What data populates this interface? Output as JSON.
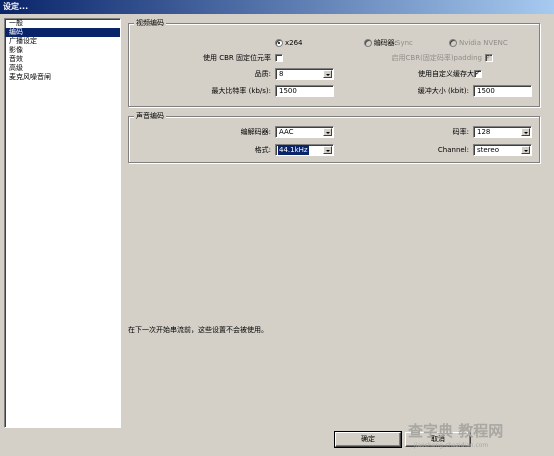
{
  "window": {
    "title": "设定..."
  },
  "nav": {
    "items": [
      "一般",
      "编码",
      "广播设定",
      "影像",
      "音效",
      "高级",
      "麦克风噪音闸"
    ]
  },
  "video_group": {
    "legend": "视频编码",
    "encoder_label": "编码器:",
    "opt_x264": "x264",
    "opt_quicksync": "Quick Sync",
    "opt_nvenc": "Nvidia NVENC",
    "cbr_label": "使用 CBR 固定位元率",
    "cbr_padding_label": "启用CBR(固定码率)padding",
    "cbr_padding_mark": "✓",
    "quality_label": "品质:",
    "quality_value": "8",
    "custom_buffer_label": "使用自定义缓存大小",
    "custom_buffer_mark": "✓",
    "max_bitrate_label": "最大比特率 (kb/s):",
    "max_bitrate_value": "1500",
    "buffer_size_label": "缓冲大小 (kbit):",
    "buffer_size_value": "1500"
  },
  "audio_group": {
    "legend": "声音编码",
    "codec_label": "编解码器:",
    "codec_value": "AAC",
    "bitrate_label": "码率:",
    "bitrate_value": "128",
    "format_label": "格式:",
    "format_value": "44.1kHz",
    "channel_label": "Channel:",
    "channel_value": "stereo"
  },
  "note": "在下一次开始串流前，这些设置不会被使用。",
  "buttons": {
    "ok": "确定",
    "cancel": "取消"
  },
  "watermark": {
    "main": "查字典 教程网",
    "sub": "jiaocheng.chazidian.com"
  }
}
